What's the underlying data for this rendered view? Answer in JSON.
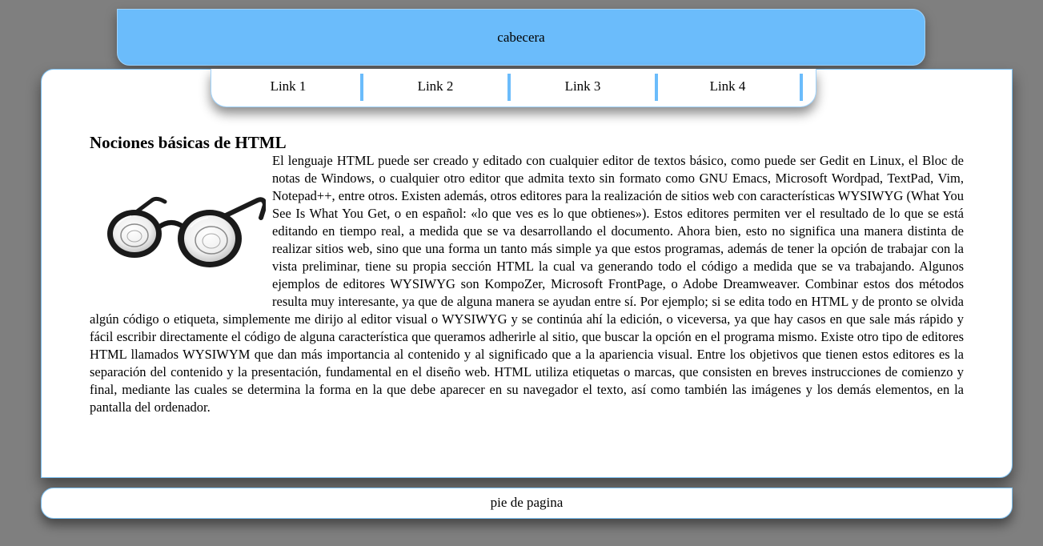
{
  "header": {
    "title": "cabecera"
  },
  "nav": {
    "items": [
      {
        "label": "Link 1"
      },
      {
        "label": "Link 2"
      },
      {
        "label": "Link 3"
      },
      {
        "label": "Link 4"
      }
    ]
  },
  "article": {
    "title": "Nociones básicas de HTML",
    "image_icon": "glasses-icon",
    "body": "El lenguaje HTML puede ser creado y editado con cualquier editor de textos básico, como puede ser Gedit en Linux, el Bloc de notas de Windows, o cualquier otro editor que admita texto sin formato como GNU Emacs, Microsoft Wordpad, TextPad, Vim, Notepad++, entre otros. Existen además, otros editores para la realización de sitios web con características WYSIWYG (What You See Is What You Get, o en español: «lo que ves es lo que obtienes»). Estos editores permiten ver el resultado de lo que se está editando en tiempo real, a medida que se va desarrollando el documento. Ahora bien, esto no significa una manera distinta de realizar sitios web, sino que una forma un tanto más simple ya que estos programas, además de tener la opción de trabajar con la vista preliminar, tiene su propia sección HTML la cual va generando todo el código a medida que se va trabajando. Algunos ejemplos de editores WYSIWYG son KompoZer, Microsoft FrontPage, o Adobe Dreamweaver. Combinar estos dos métodos resulta muy interesante, ya que de alguna manera se ayudan entre sí. Por ejemplo; si se edita todo en HTML y de pronto se olvida algún código o etiqueta, simplemente me dirijo al editor visual o WYSIWYG y se continúa ahí la edición, o viceversa, ya que hay casos en que sale más rápido y fácil escribir directamente el código de alguna característica que queramos adherirle al sitio, que buscar la opción en el programa mismo. Existe otro tipo de editores HTML llamados WYSIWYM que dan más importancia al contenido y al significado que a la apariencia visual. Entre los objetivos que tienen estos editores es la separación del contenido y la presentación, fundamental en el diseño web. HTML utiliza etiquetas o marcas, que consisten en breves instrucciones de comienzo y final, mediante las cuales se determina la forma en la que debe aparecer en su navegador el texto, así como también las imágenes y los demás elementos, en la pantalla del ordenador."
  },
  "footer": {
    "text": "pie de pagina"
  },
  "colors": {
    "background": "#7f7f7f",
    "accent": "#6bbcfb",
    "panel": "#ffffff",
    "border": "#7cc0f2"
  }
}
